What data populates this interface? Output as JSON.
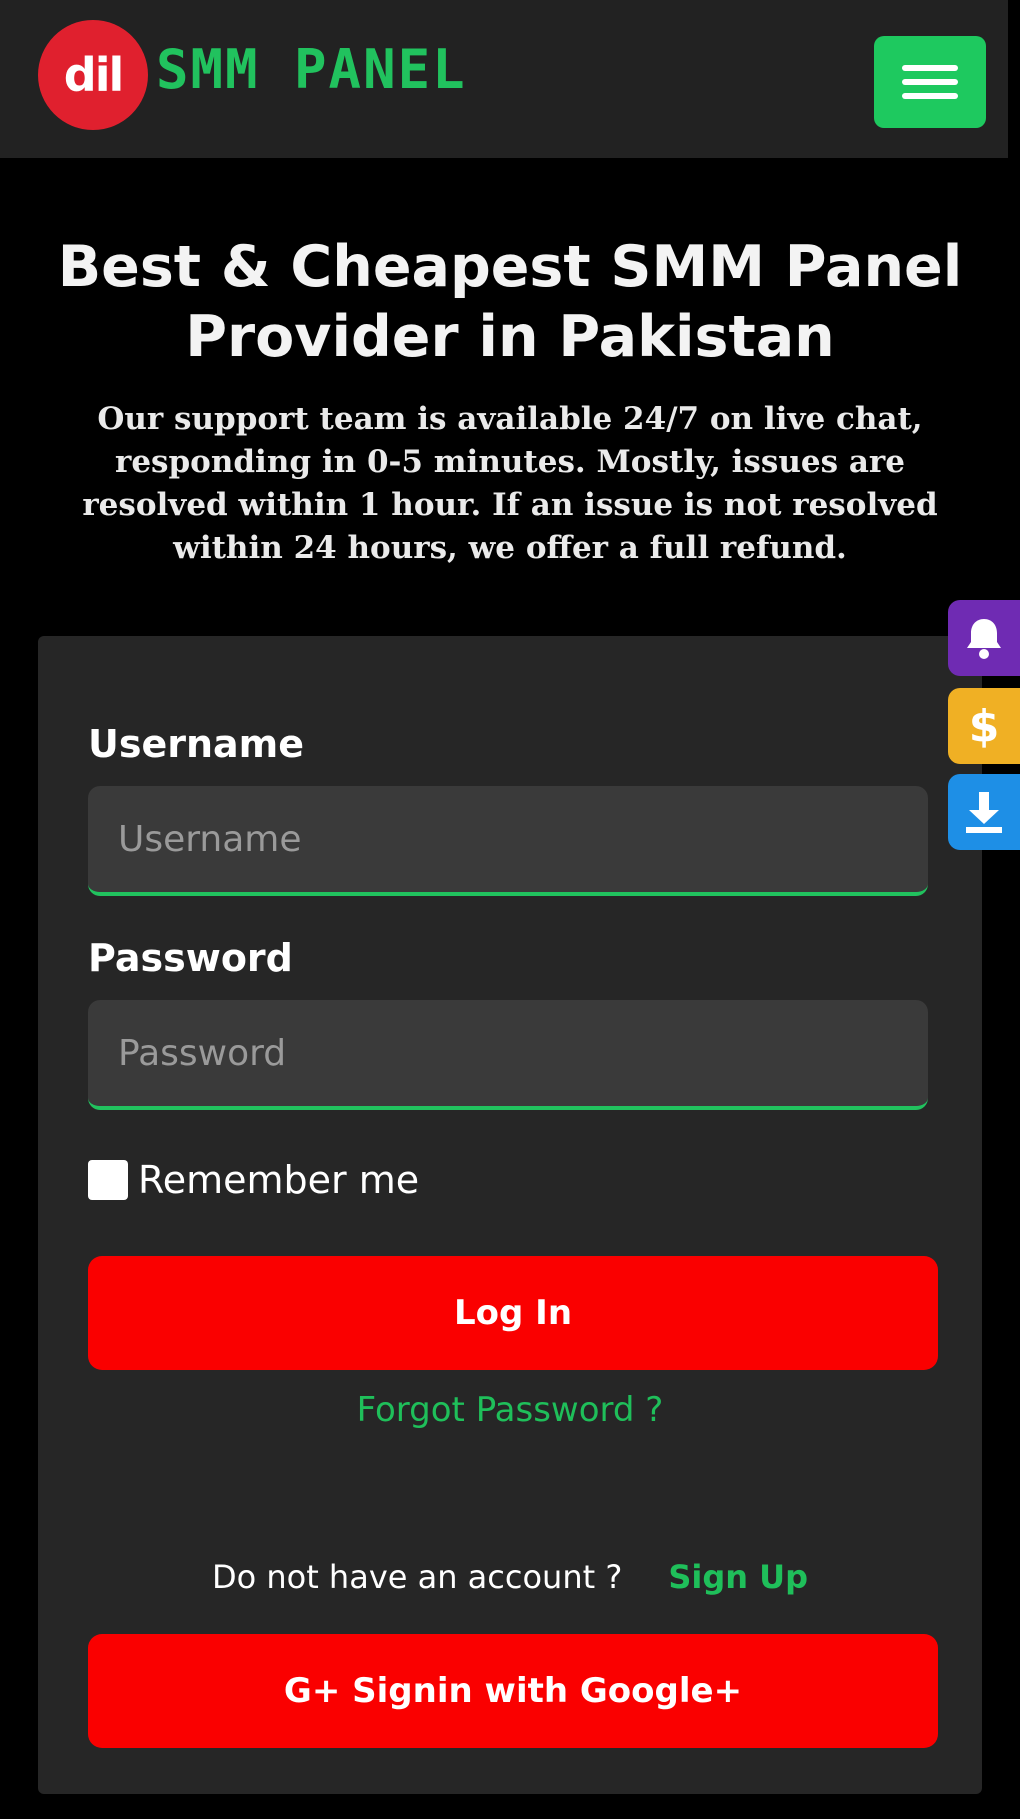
{
  "navbar": {
    "logo_badge_text": "dil",
    "logo_text": "SMM PANEL",
    "menu_icon": "hamburger-icon"
  },
  "hero": {
    "title": "Best & Cheapest SMM Panel Provider in Pakistan",
    "subtitle": "Our support team is available 24/7 on live chat, responding in 0-5 minutes. Mostly, issues are resolved within 1 hour. If an issue is not resolved within 24 hours, we offer a full refund."
  },
  "login_form": {
    "username_label": "Username",
    "username_placeholder": "Username",
    "username_value": "",
    "password_label": "Password",
    "password_placeholder": "Password",
    "password_value": "",
    "remember_label": "Remember me",
    "remember_checked": false,
    "login_button": "Log In",
    "forgot_link": "Forgot Password ?",
    "no_account_text": "Do not have an account ?",
    "signup_link": "Sign Up",
    "google_button": "G+ Signin with Google+"
  },
  "side_tabs": [
    {
      "icon": "bell-icon",
      "color": "#6f2bb3"
    },
    {
      "icon": "dollar-icon",
      "glyph": "$",
      "color": "#f0b024"
    },
    {
      "icon": "download-icon",
      "color": "#1e8fe6"
    }
  ],
  "colors": {
    "brand_green": "#21c25e",
    "button_red": "#fa0000",
    "logo_red": "#e0202e"
  }
}
